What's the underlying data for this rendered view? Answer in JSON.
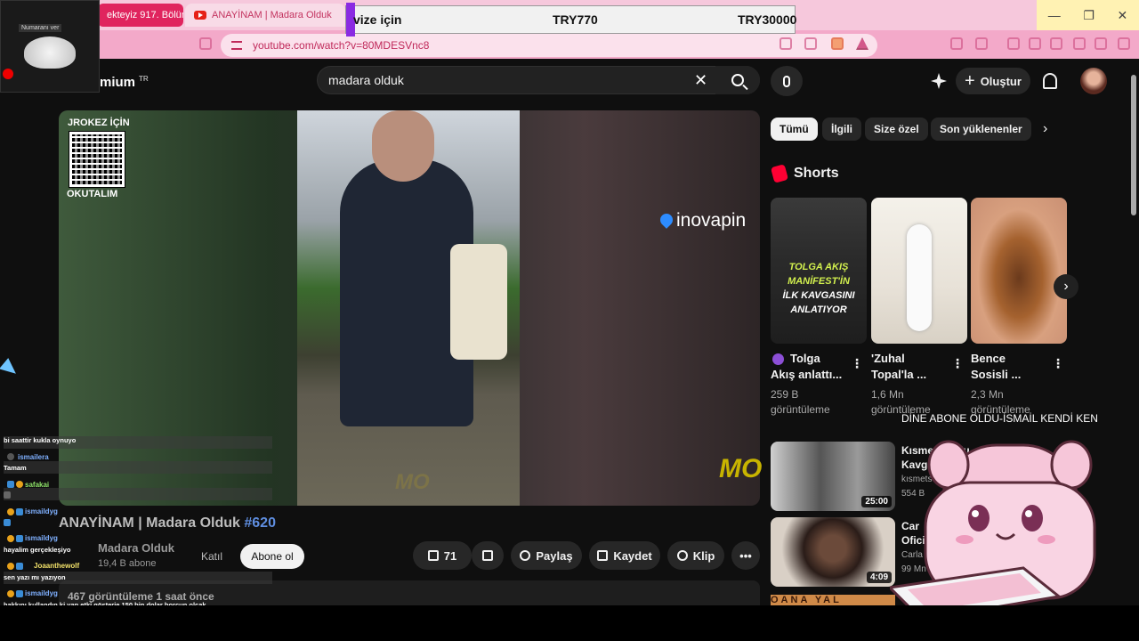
{
  "browser": {
    "tabs": [
      {
        "label": "ekteyiz 917. Bölüm"
      },
      {
        "label": "ANAYİNAM | Madara Olduk"
      }
    ],
    "url": "youtube.com/watch?v=80MDESVnc8",
    "window_controls": [
      "—",
      "❐",
      "✕"
    ]
  },
  "price_overlay": {
    "label": "vize için",
    "price1": "TRY770",
    "price2": "TRY30000"
  },
  "webcam": {
    "label": "Numaranı ver"
  },
  "header": {
    "brand_suffix": "mium",
    "region": "TR",
    "search_value": "madara olduk",
    "create_label": "Oluştur"
  },
  "video": {
    "qr_top": "JROKEZ İÇİN",
    "qr_bottom": "OKUTALIM",
    "sponsor": "inovapin",
    "watermark": "MO",
    "title_main": "ANAYİNAM | Madara Olduk ",
    "title_hash": "#620",
    "channel": "Madara Olduk",
    "subs": "19,4 B abone",
    "join_label": "Katıl",
    "subscribe_label": "Abone ol",
    "like_count": "71",
    "share_label": "Paylaş",
    "save_label": "Kaydet",
    "clip_label": "Klip",
    "more_label": "•••",
    "views": "467 görüntüleme  1 saat önce"
  },
  "chat": [
    {
      "user": "",
      "msg": "bi saattir kukla oynuyo"
    },
    {
      "user": "ismailera",
      "msg": "Tamam"
    },
    {
      "user": "safakai",
      "msg": ""
    },
    {
      "user": "ismaildyg",
      "msg": ""
    },
    {
      "user": "ismaildyg",
      "msg": "hayalim gerçekleşiyo"
    },
    {
      "user": "Joaanthewolf",
      "msg": "sen yazı mı yazıyon"
    },
    {
      "user": "ismaildyg",
      "msg": "hakkını kullandın ki yan etki gösterie 150 bin dolar borcun olcak"
    },
    {
      "user": "ismaildyg",
      "msg": ""
    }
  ],
  "filters": [
    {
      "label": "Tümü"
    },
    {
      "label": "İlgili"
    },
    {
      "label": "Size özel"
    },
    {
      "label": "Son yüklenenler"
    }
  ],
  "filters_next": "›",
  "shorts": {
    "title": "Shorts",
    "next": "›",
    "overlay_text": [
      "TOLGA AKIŞ",
      "MANİFEST'İN",
      "İLK KAVGASINI",
      "ANLATIYOR"
    ],
    "items": [
      {
        "title_1": "Tolga",
        "title_2": "Akış anlattı...",
        "views_1": "259 B",
        "views_2": "görüntüleme"
      },
      {
        "title_1": "'Zuhal",
        "title_2": "Topal'la ...",
        "views_1": "1,6 Mn",
        "views_2": "görüntüleme"
      },
      {
        "title_1": "Bence",
        "title_2": "Sosisli ...",
        "views_1": "2,3 Mn",
        "views_2": "görüntüleme"
      }
    ]
  },
  "marquee": "DİNE ABONE OLDU-İSMAİL KENDİ KEN",
  "recommended": [
    {
      "title_1": "Kısmetse Olu",
      "title_2": "Kavgalar",
      "channel": "kısmetse o",
      "views": "554 B",
      "duration": "25:00"
    },
    {
      "title_1": "Car",
      "title_2": "Ofici",
      "channel": "Carla M",
      "views": "99 Mn",
      "duration": "4:09"
    }
  ],
  "bottom_strip": "OANA YAL"
}
